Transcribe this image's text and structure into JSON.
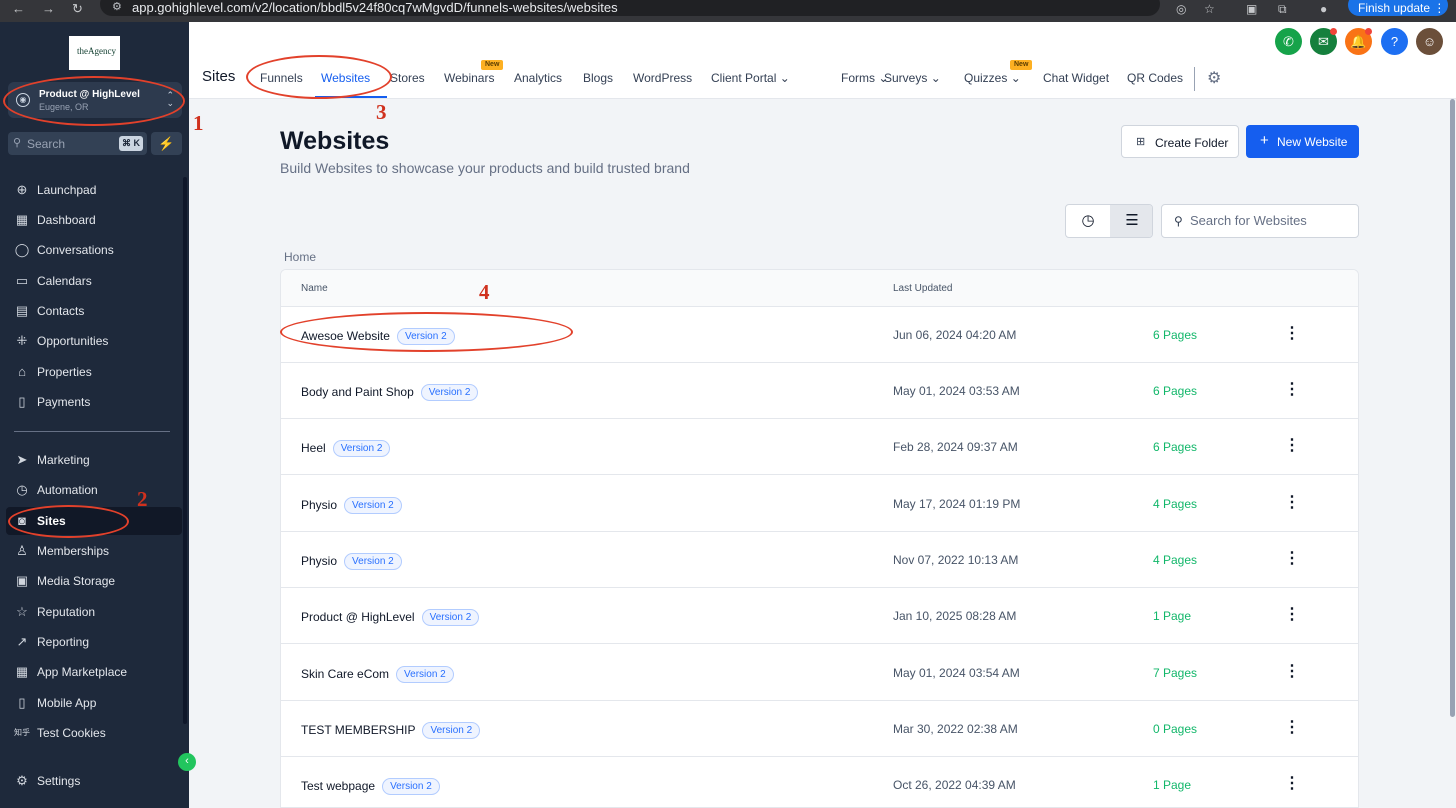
{
  "browser": {
    "url": "app.gohighlevel.com/v2/location/bbdl5v24f80cq7wMgvdD/funnels-websites/websites",
    "update_button": "Finish update"
  },
  "sidebar": {
    "logo_text": "theAgency",
    "account": {
      "name": "Product @ HighLevel",
      "location": "Eugene, OR"
    },
    "search": {
      "placeholder": "Search",
      "shortcut": "⌘ K"
    },
    "items": [
      {
        "label": "Launchpad",
        "icon": "rocket-icon"
      },
      {
        "label": "Dashboard",
        "icon": "grid-icon"
      },
      {
        "label": "Conversations",
        "icon": "chat-icon"
      },
      {
        "label": "Calendars",
        "icon": "calendar-icon"
      },
      {
        "label": "Contacts",
        "icon": "contacts-icon"
      },
      {
        "label": "Opportunities",
        "icon": "opportunities-icon"
      },
      {
        "label": "Properties",
        "icon": "home-icon"
      },
      {
        "label": "Payments",
        "icon": "payments-icon"
      },
      {
        "label": "Marketing",
        "icon": "send-icon"
      },
      {
        "label": "Automation",
        "icon": "automation-icon"
      },
      {
        "label": "Sites",
        "icon": "sites-icon",
        "active": true
      },
      {
        "label": "Memberships",
        "icon": "membership-icon"
      },
      {
        "label": "Media Storage",
        "icon": "image-icon"
      },
      {
        "label": "Reputation",
        "icon": "star-icon"
      },
      {
        "label": "Reporting",
        "icon": "chart-line-icon"
      },
      {
        "label": "App Marketplace",
        "icon": "apps-icon"
      },
      {
        "label": "Mobile App",
        "icon": "mobile-icon"
      },
      {
        "label": "Test Cookies",
        "icon": "translate-icon"
      }
    ],
    "settings_label": "Settings"
  },
  "header": {
    "section_title": "Sites",
    "tabs": [
      {
        "label": "Funnels"
      },
      {
        "label": "Websites",
        "active": true
      },
      {
        "label": "Stores"
      },
      {
        "label": "Webinars",
        "badge": "New"
      },
      {
        "label": "Analytics"
      },
      {
        "label": "Blogs"
      },
      {
        "label": "WordPress"
      },
      {
        "label": "Client Portal",
        "dropdown": true
      },
      {
        "label": "Forms",
        "dropdown": true
      },
      {
        "label": "Surveys",
        "dropdown": true
      },
      {
        "label": "Quizzes",
        "dropdown": true,
        "badge": "New"
      },
      {
        "label": "Chat Widget"
      },
      {
        "label": "QR Codes"
      }
    ],
    "actions": [
      {
        "icon": "phone-icon",
        "color": "#16a34a"
      },
      {
        "icon": "megaphone-icon",
        "color": "#15803d"
      },
      {
        "icon": "bell-icon",
        "color": "#f97316"
      },
      {
        "icon": "help-icon",
        "color": "#1d6ff2"
      }
    ]
  },
  "main": {
    "title": "Websites",
    "subtitle": "Build Websites to showcase your products and build trusted brand",
    "create_folder_label": "Create Folder",
    "new_website_label": "New Website",
    "search_placeholder": "Search for Websites",
    "breadcrumb": "Home",
    "columns": {
      "name": "Name",
      "last_updated": "Last Updated"
    },
    "rows": [
      {
        "name": "Awesoe Website",
        "version": "Version 2",
        "updated": "Jun 06, 2024 04:20 AM",
        "pages": "6 Pages"
      },
      {
        "name": "Body and Paint Shop",
        "version": "Version 2",
        "updated": "May 01, 2024 03:53 AM",
        "pages": "6 Pages"
      },
      {
        "name": "Heel",
        "version": "Version 2",
        "updated": "Feb 28, 2024 09:37 AM",
        "pages": "6 Pages"
      },
      {
        "name": "Physio",
        "version": "Version 2",
        "updated": "May 17, 2024 01:19 PM",
        "pages": "4 Pages"
      },
      {
        "name": "Physio",
        "version": "Version 2",
        "updated": "Nov 07, 2022 10:13 AM",
        "pages": "4 Pages"
      },
      {
        "name": "Product @ HighLevel",
        "version": "Version 2",
        "updated": "Jan 10, 2025 08:28 AM",
        "pages": "1 Page"
      },
      {
        "name": "Skin Care eCom",
        "version": "Version 2",
        "updated": "May 01, 2024 03:54 AM",
        "pages": "7 Pages"
      },
      {
        "name": "TEST MEMBERSHIP",
        "version": "Version 2",
        "updated": "Mar 30, 2022 02:38 AM",
        "pages": "0 Pages"
      },
      {
        "name": "Test webpage",
        "version": "Version 2",
        "updated": "Oct 26, 2022 04:39 AM",
        "pages": "1 Page"
      }
    ]
  },
  "annotations": [
    "1",
    "2",
    "3",
    "4"
  ],
  "colors": {
    "accent": "#155eef",
    "sidebar_bg": "#1e293b",
    "annotation": "#e2412b",
    "pages_green": "#12b76a"
  }
}
